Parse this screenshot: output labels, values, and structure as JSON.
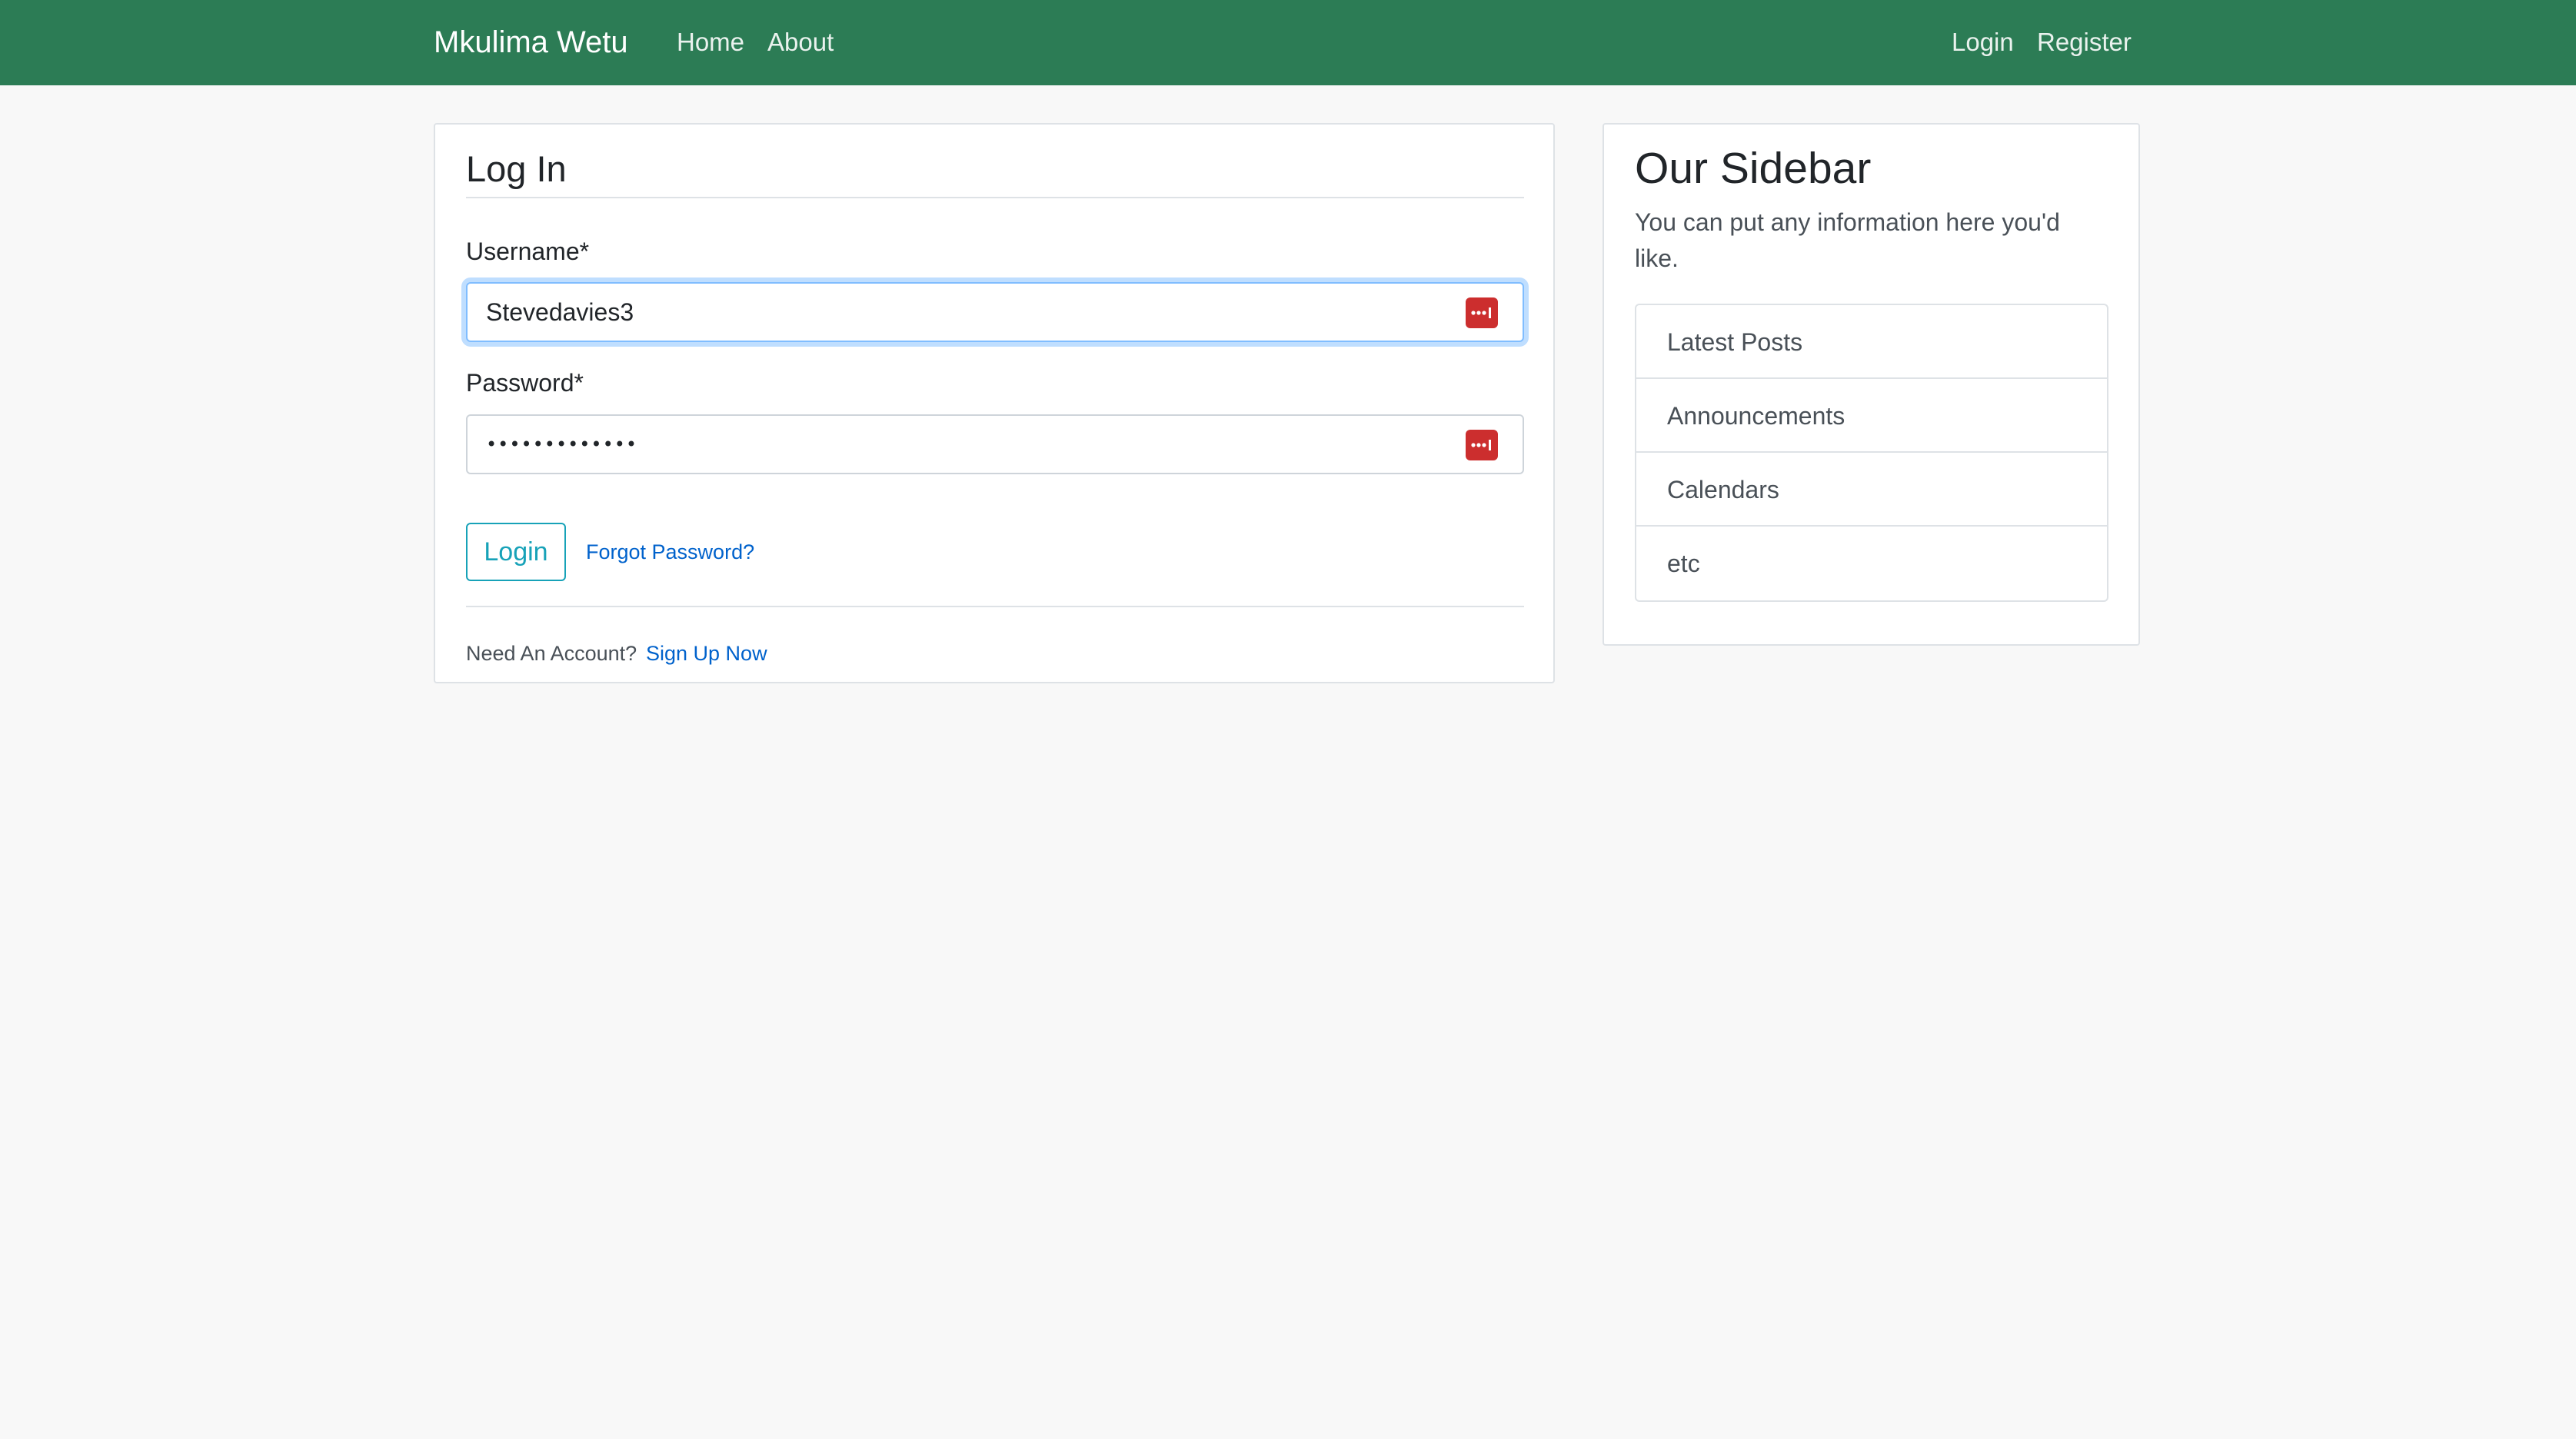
{
  "navbar": {
    "brand": "Mkulima Wetu",
    "left_links": [
      "Home",
      "About"
    ],
    "right_links": [
      "Login",
      "Register"
    ],
    "background_color": "#2c7c55"
  },
  "login_form": {
    "title": "Log In",
    "username": {
      "label": "Username*",
      "value": "Stevedavies3"
    },
    "password": {
      "label": "Password*",
      "value": "•••••••••••••"
    },
    "password_manager_icon": "password-manager-icon",
    "submit_label": "Login",
    "forgot_password": "Forgot Password?",
    "need_account": "Need An Account?",
    "sign_up": "Sign Up Now"
  },
  "sidebar": {
    "title": "Our Sidebar",
    "description": "You can put any information here you'd like.",
    "items": [
      "Latest Posts",
      "Announcements",
      "Calendars",
      "etc"
    ]
  }
}
